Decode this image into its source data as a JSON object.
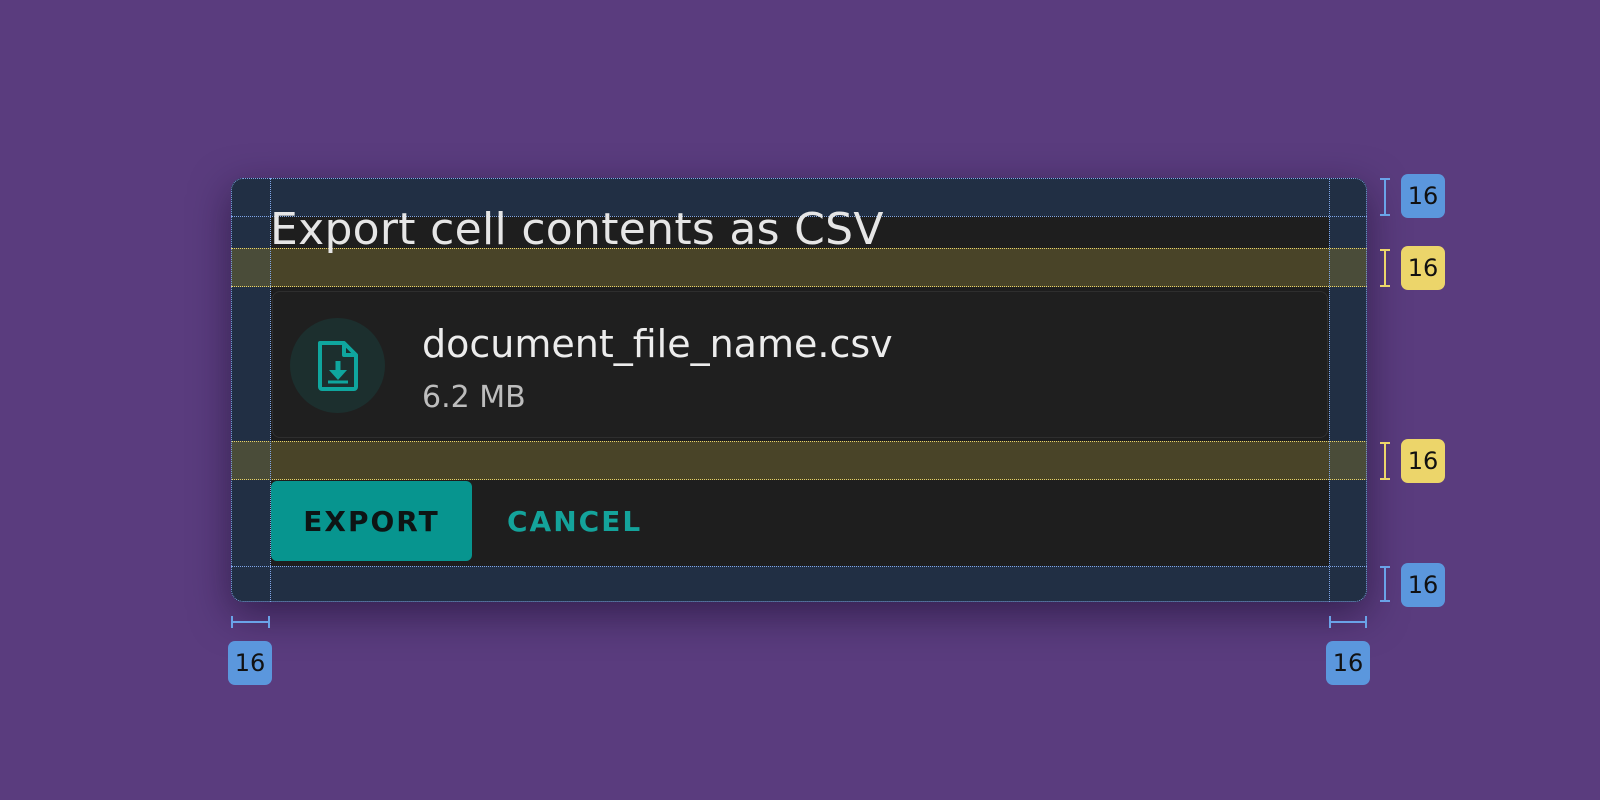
{
  "dialog": {
    "title": "Export cell contents as CSV",
    "file": {
      "icon": "file-download-icon",
      "name": "document_file_name.csv",
      "size": "6.2 MB"
    },
    "actions": {
      "export_label": "EXPORT",
      "cancel_label": "CANCEL"
    }
  },
  "annotations": {
    "padding_top": "16",
    "gap_title_card": "16",
    "gap_card_actions": "16",
    "padding_bottom": "16",
    "padding_left": "16",
    "padding_right": "16"
  },
  "colors": {
    "background": "#5a3c7e",
    "surface": "#1e1e1e",
    "accent": "#07958f",
    "padding_marker": "#5b97dd",
    "gap_marker": "#ecd56a"
  }
}
